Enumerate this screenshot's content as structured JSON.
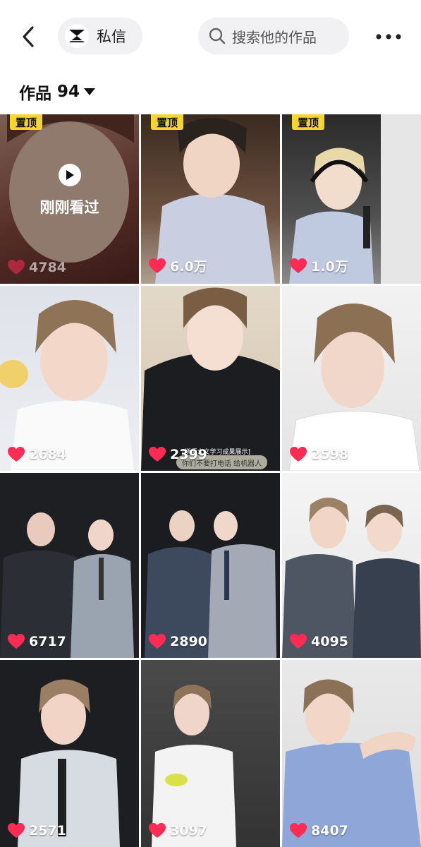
{
  "header": {
    "back_icon": "chevron-left-icon",
    "message_label": "私信",
    "search_placeholder": "搜索他的作品",
    "more_icon": "more-horizontal-icon"
  },
  "works": {
    "title": "作品",
    "count": "94"
  },
  "colors": {
    "pin_yellow": "#f6d431",
    "heart_red": "#fe2c55",
    "pill_bg": "#f1f1f3"
  },
  "videos": [
    {
      "likes": "4784",
      "pinned": true,
      "pin_label": "置顶",
      "recently_viewed": true,
      "recent_label": "刚刚看过"
    },
    {
      "likes": "6.0万",
      "pinned": true,
      "pin_label": "置顶"
    },
    {
      "likes": "1.0万",
      "pinned": true,
      "pin_label": "置顶"
    },
    {
      "likes": "2684"
    },
    {
      "likes": "2399",
      "caption_top": "[浙师大文学习成果展示]",
      "caption_strip": "你们不要打电话 给机器人"
    },
    {
      "likes": "2598"
    },
    {
      "likes": "6717"
    },
    {
      "likes": "2890"
    },
    {
      "likes": "4095"
    },
    {
      "likes": "2571"
    },
    {
      "likes": "3097"
    },
    {
      "likes": "8407"
    }
  ]
}
